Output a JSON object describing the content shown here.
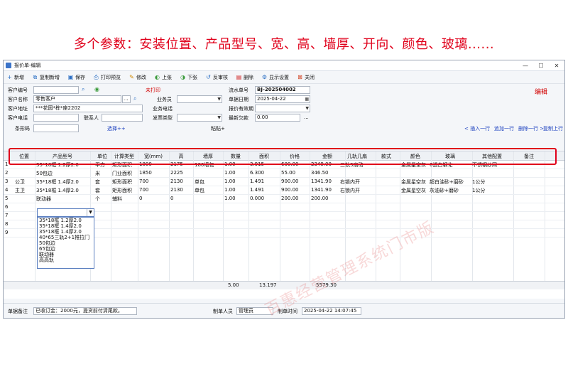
{
  "headline": "多个参数：安装位置、产品型号、宽、高、墙厚、开向、颜色、玻璃......",
  "window": {
    "title": "报价单-编辑",
    "min": "—",
    "max": "☐",
    "close": "✕"
  },
  "toolbar": [
    {
      "label": "新增",
      "icon": "+"
    },
    {
      "label": "复制新增",
      "icon": "⧉"
    },
    {
      "label": "保存",
      "icon": "▣"
    },
    {
      "label": "打印预览",
      "icon": "⎙"
    },
    {
      "label": "修改",
      "icon": "✎"
    },
    {
      "label": "上张",
      "icon": "◐"
    },
    {
      "label": "下张",
      "icon": "◑"
    },
    {
      "label": "反审核",
      "icon": "↺"
    },
    {
      "label": "删除",
      "icon": "▤"
    },
    {
      "label": "显示设置",
      "icon": "⚙"
    },
    {
      "label": "关闭",
      "icon": "⊠"
    }
  ],
  "form": {
    "customer_no_label": "客户编号",
    "customer_no": "",
    "customer_name_label": "客户名称",
    "customer_name": "零售客户",
    "customer_name_btn": "...",
    "customer_addr_label": "客户地址",
    "customer_addr": "***花园*栋*座2202",
    "customer_phone_label": "客户电话",
    "customer_phone": "",
    "contact_label": "联系人",
    "contact": "",
    "print_status": "未打印",
    "salesman_label": "业务员",
    "salesman": "",
    "biz_phone_label": "业务电话",
    "biz_phone": "",
    "invoice_type_label": "发票类型",
    "invoice_type": "",
    "serial_label": "流水单号",
    "serial": "BJ-202504002",
    "date_label": "单据日期",
    "date": "2025-04-22",
    "valid_label": "报价有效期",
    "valid": "",
    "latest_debt_label": "最新欠款",
    "latest_debt": "0.00",
    "latest_debt_btn": "...",
    "editor_mark": "编辑"
  },
  "tools": {
    "barcode_label": "条形码",
    "select": "选择++",
    "paste": "粘贴+",
    "insert": "< 插入一行",
    "append": "追加一行",
    "delete": "删除一行 >",
    "copy": "复制上行"
  },
  "grid": {
    "headers": [
      "位置",
      "产品型号",
      "单位",
      "计算类型",
      "宽(mm)",
      "高",
      "墙厚",
      "数量",
      "面积",
      "价格",
      "金额",
      "几轨几扇",
      "款式",
      "颜色",
      "玻璃",
      "其他配置",
      "备注"
    ],
    "rows": [
      {
        "no": "1",
        "c": [
          "",
          "35*18框 1.2厚2.0",
          "平方",
          "矩形面积",
          "1800",
          "2175",
          "180墙包",
          "1.00",
          "3.915",
          "600.00",
          "2349.00",
          "三轨3扇动",
          "",
          "金属星空灰",
          "6透白钢化",
          "不锈钢纱网",
          ""
        ]
      },
      {
        "no": "2",
        "c": [
          "",
          "50包边",
          "米",
          "门业面积",
          "1850",
          "2225",
          "",
          "1.00",
          "6.300",
          "55.00",
          "346.50",
          "",
          "",
          "",
          "",
          "",
          ""
        ]
      },
      {
        "no": "3",
        "c": [
          "公卫",
          "35*18框 1.4厚2.0",
          "套",
          "矩形面积",
          "700",
          "2130",
          "单包",
          "1.00",
          "1.491",
          "900.00",
          "1341.90",
          "右锁内开",
          "",
          "金属星空灰",
          "超白油砂+磨砂",
          "1公分",
          ""
        ]
      },
      {
        "no": "4",
        "c": [
          "主卫",
          "35*18框 1.4厚2.0",
          "套",
          "矩形面积",
          "700",
          "2130",
          "单包",
          "1.00",
          "1.491",
          "900.00",
          "1341.90",
          "右锁内开",
          "",
          "金属星空灰",
          "灰油砂+磨砂",
          "1公分",
          ""
        ]
      },
      {
        "no": "5",
        "c": [
          "",
          "联动器",
          "个",
          "辅料",
          "0",
          "0",
          "",
          "1.00",
          "0.000",
          "200.00",
          "200.00",
          "",
          "",
          "",
          "",
          "",
          ""
        ]
      },
      {
        "no": "6",
        "c": [
          "",
          "",
          "",
          "",
          "",
          "",
          "",
          "",
          "",
          "",
          "",
          "",
          "",
          "",
          "",
          "",
          ""
        ]
      },
      {
        "no": "7",
        "c": [
          "",
          "",
          "",
          "",
          "",
          "",
          "",
          "",
          "",
          "",
          "",
          "",
          "",
          "",
          "",
          "",
          ""
        ]
      },
      {
        "no": "8",
        "c": [
          "",
          "",
          "",
          "",
          "",
          "",
          "",
          "",
          "",
          "",
          "",
          "",
          "",
          "",
          "",
          "",
          ""
        ]
      },
      {
        "no": "9",
        "c": [
          "",
          "",
          "",
          "",
          "",
          "",
          "",
          "",
          "",
          "",
          "",
          "",
          "",
          "",
          "",
          "",
          ""
        ]
      }
    ],
    "totals": {
      "qty": "5.00",
      "area": "13.197",
      "amount": "5579.30"
    },
    "dropdown_options": [
      "35*18框 1.2厚2.0",
      "35*18框 1.4厚2.0",
      "35*18框 1.4厚2.0",
      "40*65三轨2+1推拉门",
      "50包边",
      "65包边",
      "联动器",
      "高高轨"
    ]
  },
  "footer": {
    "remark_label": "单据备注",
    "remark": "已收订金：2000元，提货前付清尾款。",
    "maker_label": "制单人员",
    "maker": "管理员",
    "time_label": "制单时间",
    "time": "2025-04-22 14:07:45"
  },
  "watermark": "百惠经营管理系统门市版"
}
